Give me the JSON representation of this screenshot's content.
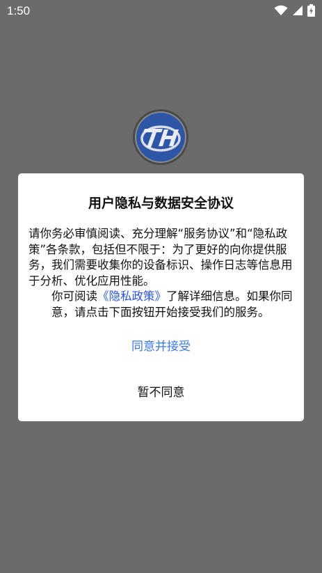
{
  "status_bar": {
    "time": "1:50",
    "icons": [
      "wifi-icon",
      "cellular-signal-icon",
      "battery-charging-icon"
    ]
  },
  "app": {
    "logo_icon": "th-logo",
    "brand_colors": {
      "logo_blue": "#2f56a6",
      "logo_ring": "#555555"
    }
  },
  "dialog": {
    "title": "用户隐私与数据安全协议",
    "paragraph1": "请你务必审慎阅读、充分理解“服务协议”和“隐私政策”各条款，包括但不限于：为了更好的向你提供服务，我们需要收集你的设备标识、操作日志等信息用于分析、优化应用性能。",
    "paragraph2_prefix": "你可阅读",
    "privacy_link": "《隐私政策》",
    "paragraph2_suffix": "了解详细信息。如果你同意，请点击下面按钮开始接受我们的服务。",
    "accept_label": "同意并接受",
    "decline_label": "暂不同意"
  },
  "colors": {
    "overlay": "#6b6b6b",
    "link": "#2a54e8",
    "accept": "#3b79e6"
  }
}
